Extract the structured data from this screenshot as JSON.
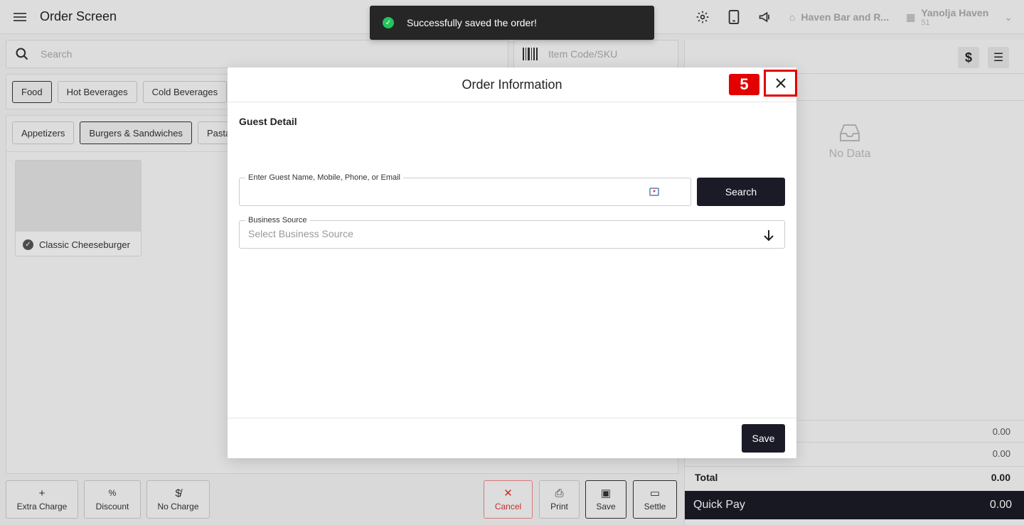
{
  "header": {
    "title": "Order Screen",
    "property_name": "Haven Bar and R...",
    "org_name": "Yanolja Haven",
    "org_sub": "51",
    "icons": [
      "settings-icon",
      "device-icon",
      "megaphone-icon"
    ]
  },
  "search": {
    "placeholder": "Search"
  },
  "sku": {
    "placeholder": "Item Code/SKU"
  },
  "categories": [
    "Food",
    "Hot Beverages",
    "Cold Beverages"
  ],
  "subcategories": [
    "Appetizers",
    "Burgers & Sandwiches",
    "Pasta"
  ],
  "items": [
    {
      "name": "Classic Cheeseburger"
    }
  ],
  "actions": {
    "extra_charge": "Extra Charge",
    "discount": "Discount",
    "no_charge": "No Charge",
    "cancel": "Cancel",
    "print": "Print",
    "save": "Save",
    "settle": "Settle"
  },
  "order_panel": {
    "no_data": "No Data",
    "subtotal_1": "0.00",
    "subtotal_2": "0.00",
    "total_label": "Total",
    "total_value": "0.00",
    "quick_pay_label": "Quick Pay",
    "quick_pay_value": "0.00"
  },
  "toast": {
    "message": "Successfully saved the order!"
  },
  "modal": {
    "title": "Order Information",
    "step_number": "5",
    "section_title": "Guest Detail",
    "guest_field_label": "Enter Guest Name, Mobile, Phone, or Email",
    "guest_field_value": "",
    "search_button": "Search",
    "business_source_label": "Business Source",
    "business_source_placeholder": "Select Business Source",
    "save_button": "Save"
  },
  "colors": {
    "dark_button": "#1b1b28",
    "highlight_red": "#e30000",
    "toast_bg": "#262626",
    "success_green": "#22c55e"
  }
}
